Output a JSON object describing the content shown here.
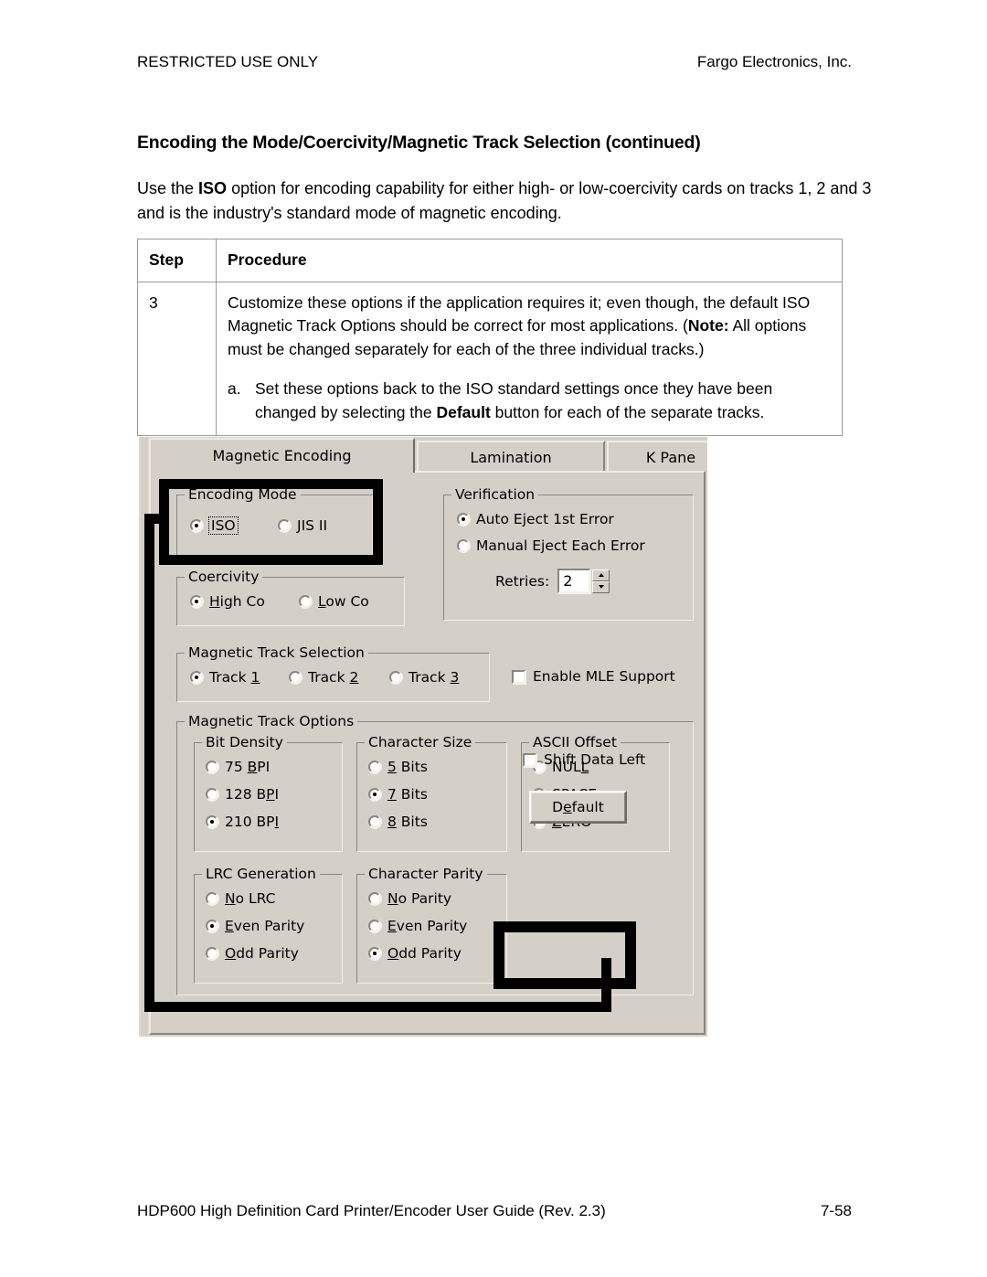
{
  "header": {
    "left": "RESTRICTED USE ONLY",
    "right": "Fargo Electronics, Inc."
  },
  "section": {
    "title": "Encoding the Mode/Coercivity/Magnetic Track Selection (continued)",
    "intro_pre": "Use the ",
    "intro_bold": "ISO",
    "intro_post": " option for encoding capability for either high- or low-coercivity cards on tracks 1, 2 and 3 and is the industry's standard mode of magnetic encoding."
  },
  "table": {
    "headers": [
      "Step",
      "Procedure"
    ],
    "rows": [
      {
        "step": "3",
        "para_a": "Customize these options if the application requires it; even though, the default ISO Magnetic Track Options should be correct for most applications. (",
        "para_note": "Note:",
        "para_b": "  All options must be changed separately for each of the three individual tracks.)",
        "sub_marker": "a.",
        "sub_pre": "Set these options back to the ISO standard settings once they have been changed by selecting the ",
        "sub_bold": "Default",
        "sub_post": " button for each of the separate tracks."
      }
    ]
  },
  "dialog": {
    "tabs": [
      {
        "label": "Magnetic Encoding",
        "active": true
      },
      {
        "label": "Lamination",
        "active": false
      },
      {
        "label": "K Pane",
        "active": false
      }
    ],
    "encoding_mode": {
      "title": "Encoding Mode",
      "options": [
        {
          "label": "ISO",
          "selected": true,
          "focused": true
        },
        {
          "label": "JIS II",
          "selected": false,
          "focused": false
        }
      ]
    },
    "verification": {
      "title": "Verification",
      "options": [
        {
          "label": "Auto Eject 1st Error",
          "selected": true
        },
        {
          "label": "Manual Eject Each Error",
          "selected": false
        }
      ],
      "retries_label": "Retries:",
      "retries_value": "2"
    },
    "coercivity": {
      "title": "Coercivity",
      "options": [
        {
          "pre": "",
          "u": "H",
          "post": "igh Co",
          "selected": true
        },
        {
          "pre": "",
          "u": "L",
          "post": "ow Co",
          "selected": false
        }
      ]
    },
    "track_selection": {
      "title": "Magnetic Track Selection",
      "options": [
        {
          "pre": "Track ",
          "u": "1",
          "post": "",
          "selected": true
        },
        {
          "pre": "Track ",
          "u": "2",
          "post": "",
          "selected": false
        },
        {
          "pre": "Track ",
          "u": "3",
          "post": "",
          "selected": false
        }
      ],
      "mle_checkbox": {
        "label": "Enable MLE Support",
        "checked": false
      }
    },
    "track_options": {
      "title": "Magnetic Track Options",
      "bit_density": {
        "title": "Bit Density",
        "options": [
          {
            "pre": "75 ",
            "u": "B",
            "post": "PI",
            "selected": false
          },
          {
            "pre": "128 B",
            "u": "P",
            "post": "I",
            "selected": false
          },
          {
            "pre": "210 BP",
            "u": "I",
            "post": "",
            "selected": true
          }
        ]
      },
      "character_size": {
        "title": "Character Size",
        "options": [
          {
            "pre": "",
            "u": "5",
            "post": " Bits",
            "selected": false
          },
          {
            "pre": "",
            "u": "7",
            "post": " Bits",
            "selected": true
          },
          {
            "pre": "",
            "u": "8",
            "post": " Bits",
            "selected": false
          }
        ]
      },
      "ascii_offset": {
        "title": "ASCII Offset",
        "options": [
          {
            "pre": "NUL",
            "u": "L",
            "post": "",
            "selected": false
          },
          {
            "pre": "",
            "u": "S",
            "post": "PACE",
            "selected": true
          },
          {
            "pre": "",
            "u": "Z",
            "post": "ERO",
            "selected": false
          }
        ]
      },
      "lrc_generation": {
        "title": "LRC Generation",
        "options": [
          {
            "pre": "",
            "u": "N",
            "post": "o LRC",
            "selected": false
          },
          {
            "pre": "",
            "u": "E",
            "post": "ven Parity",
            "selected": true
          },
          {
            "pre": "",
            "u": "O",
            "post": "dd Parity",
            "selected": false
          }
        ]
      },
      "character_parity": {
        "title": "Character Parity",
        "options": [
          {
            "pre": "",
            "u": "N",
            "post": "o Parity",
            "selected": false
          },
          {
            "pre": "",
            "u": "E",
            "post": "ven Parity",
            "selected": false
          },
          {
            "pre": "",
            "u": "O",
            "post": "dd Parity",
            "selected": true
          }
        ]
      },
      "shift_data_left": {
        "label": "Shift Data Left",
        "checked": false
      },
      "default_button": {
        "pre": "D",
        "u": "e",
        "post": "fault"
      }
    }
  },
  "footer": {
    "left": "HDP600 High Definition Card Printer/Encoder User Guide (Rev. 2.3)",
    "right": "7-58"
  },
  "colors": {
    "dialog_face": "#d4d0c8",
    "annotation": "#000000",
    "page_background": "#ffffff"
  }
}
